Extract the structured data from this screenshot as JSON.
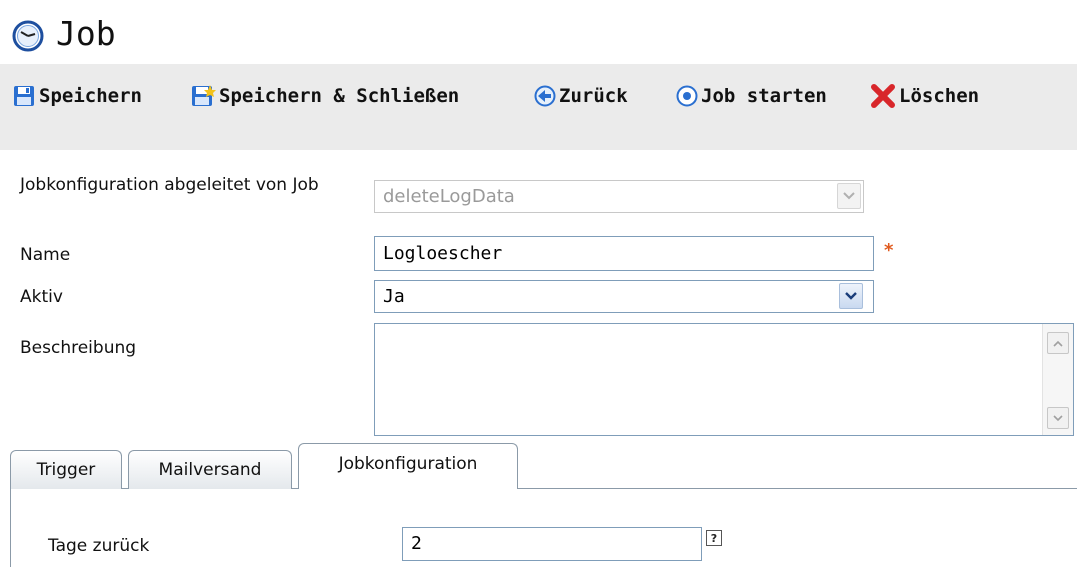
{
  "header": {
    "title": "Job",
    "icon": "clock-icon"
  },
  "toolbar": {
    "save_label": "Speichern",
    "save_close_label": "Speichern & Schließen",
    "back_label": "Zurück",
    "start_job_label": "Job starten",
    "delete_label": "Löschen"
  },
  "form": {
    "derived_label": "Jobkonfiguration abgeleitet von Job",
    "derived_value": "deleteLogData",
    "name_label": "Name",
    "name_value": "Logloescher",
    "required_marker": "*",
    "active_label": "Aktiv",
    "active_value": "Ja",
    "description_label": "Beschreibung",
    "description_value": ""
  },
  "tabs": [
    {
      "label": "Trigger",
      "active": false
    },
    {
      "label": "Mailversand",
      "active": false
    },
    {
      "label": "Jobkonfiguration",
      "active": true
    }
  ],
  "jobconfig": {
    "days_back_label": "Tage zurück",
    "days_back_value": "2",
    "help_label": "?"
  },
  "colors": {
    "toolbar_bg": "#ebebeb",
    "field_border": "#7f9db9",
    "required": "#e05a1e",
    "delete_red": "#d8262a",
    "icon_blue": "#2a6fd0"
  }
}
